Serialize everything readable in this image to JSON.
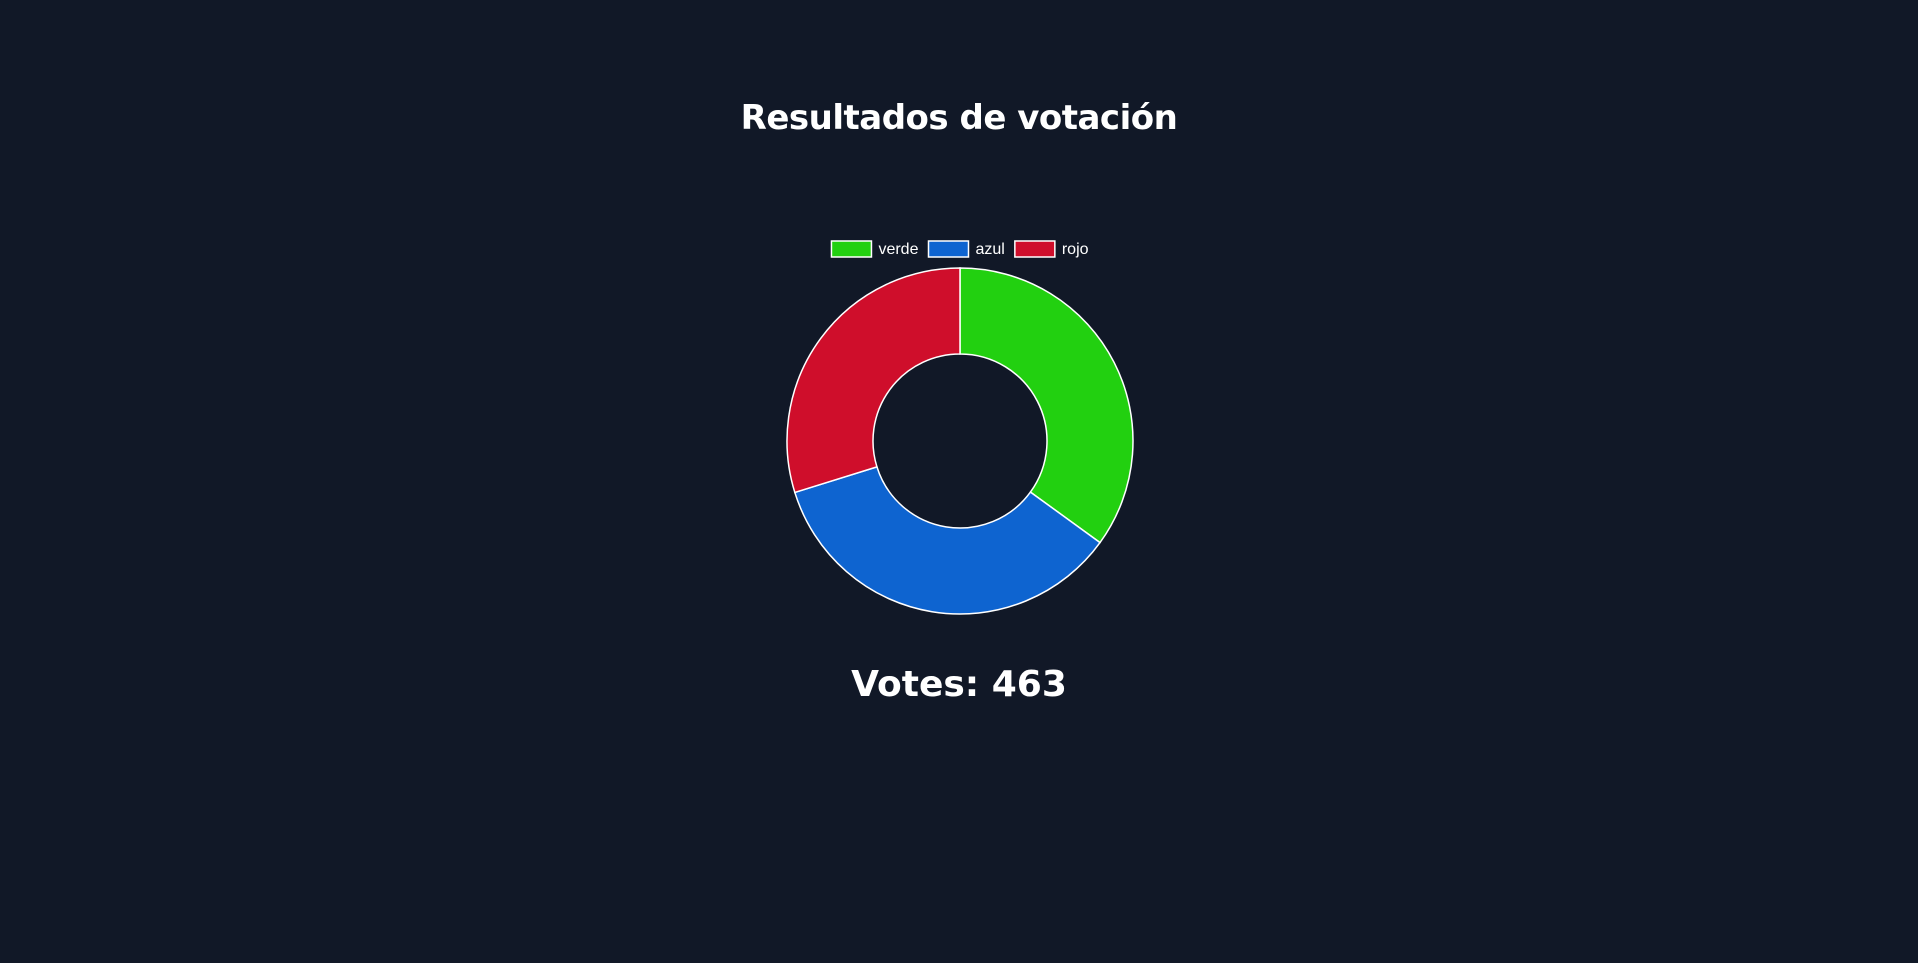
{
  "page": {
    "title": "Resultados de votación",
    "votes_text": "Votes: 463",
    "background": "#111827"
  },
  "chart_data": {
    "type": "pie",
    "donut": true,
    "categories": [
      "verde",
      "azul",
      "rojo"
    ],
    "values": [
      162,
      163,
      138
    ],
    "colors": [
      "#22d010",
      "#0e64d0",
      "#cf0e2b"
    ],
    "border_color": "#ffffff",
    "legend": "top-center"
  }
}
